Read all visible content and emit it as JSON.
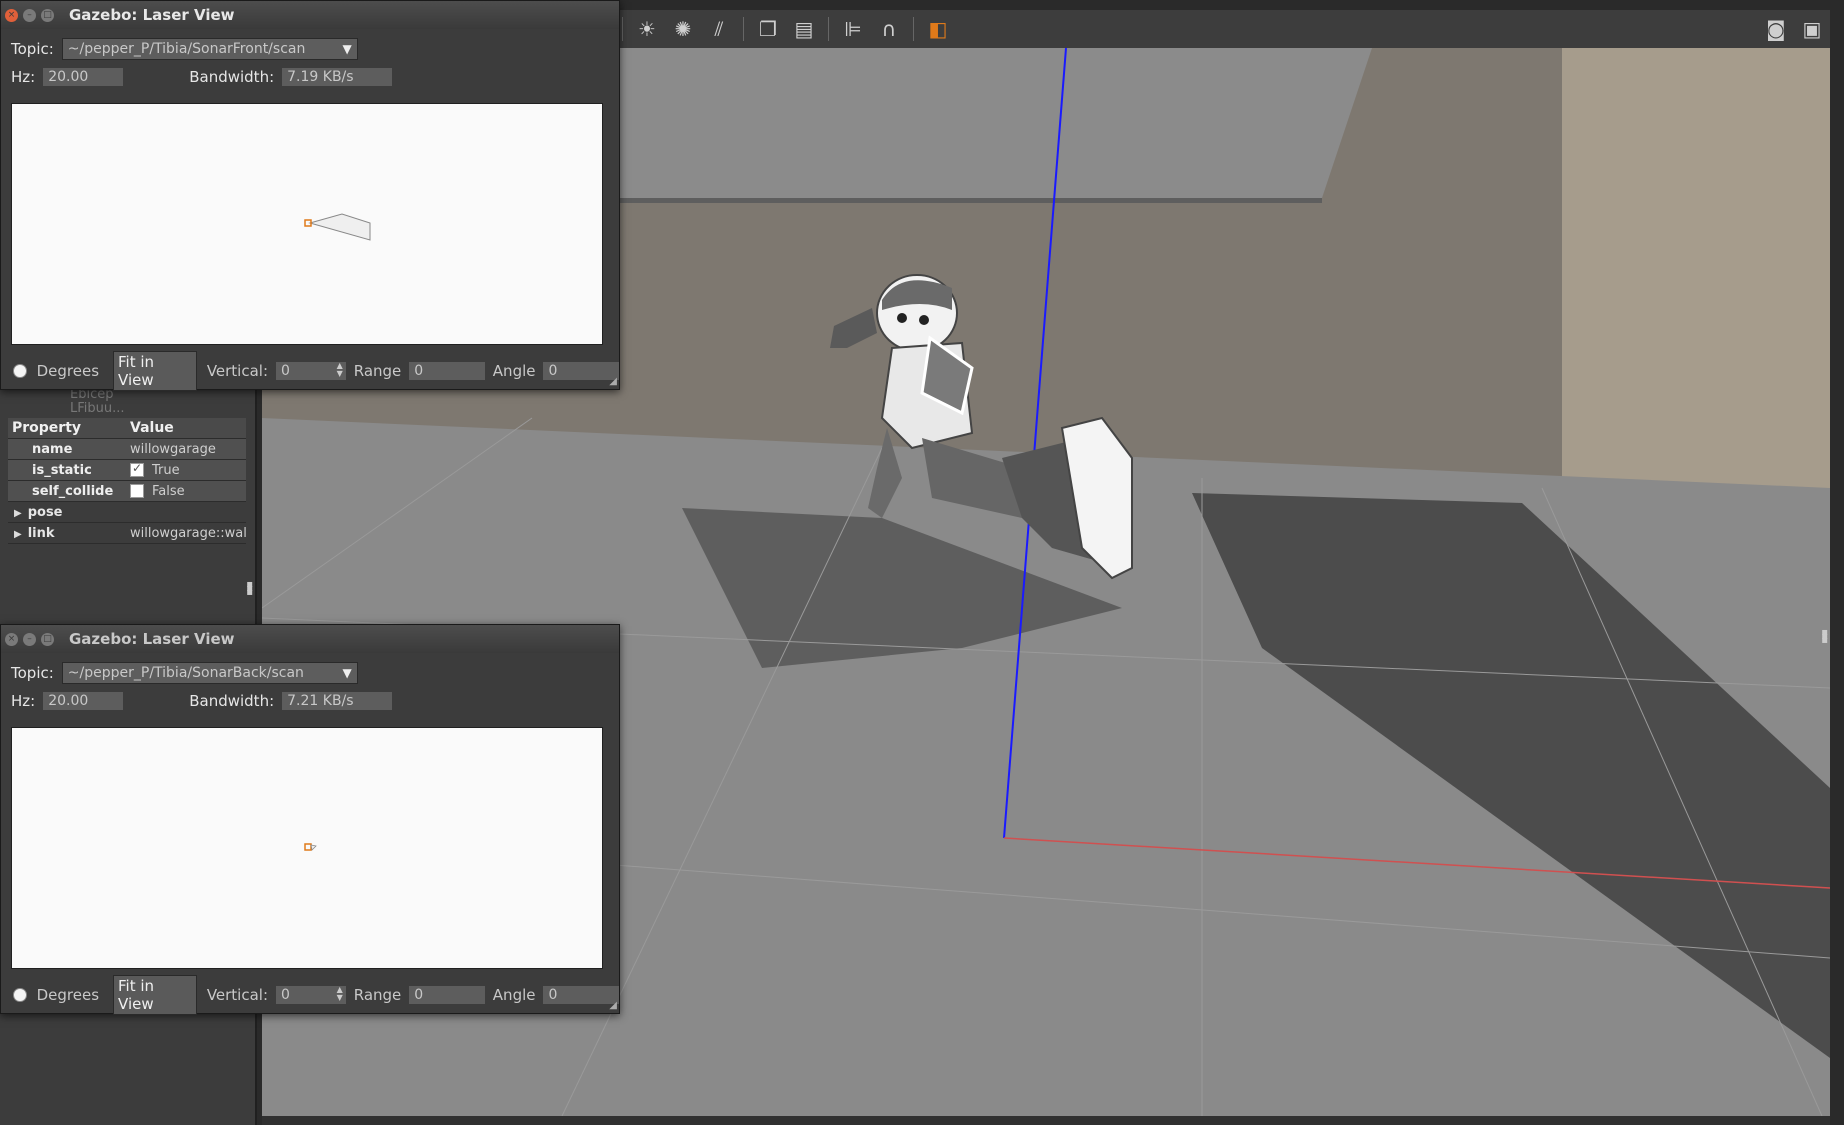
{
  "properties": {
    "header": {
      "property": "Property",
      "value": "Value"
    },
    "rows": [
      {
        "key": "name",
        "value": "willowgarage"
      },
      {
        "key": "is_static",
        "value": "True",
        "checked": true
      },
      {
        "key": "self_collide",
        "value": "False",
        "checked": false
      },
      {
        "key": "pose",
        "value": ""
      },
      {
        "key": "link",
        "value": "willowgarage::walls"
      }
    ],
    "ghost_text_1": "Ebicep",
    "ghost_text_2": "LFibuu..."
  },
  "toolbar_icons": [
    "sun-icon",
    "spotlight-icon",
    "directional-light-icon",
    "copy-icon",
    "paste-icon",
    "align-icon",
    "snap-magnet-icon",
    "view-angle-icon",
    "camera-icon",
    "log-icon"
  ],
  "laser_front": {
    "title": "Gazebo: Laser View",
    "topic_label": "Topic:",
    "topic": "~/pepper_P/Tibia/SonarFront/scan",
    "hz_label": "Hz:",
    "hz": "20.00",
    "bandwidth_label": "Bandwidth:",
    "bandwidth": "7.19 KB/s",
    "degrees_label": "Degrees",
    "fit_label": "Fit in View",
    "vertical_label": "Vertical:",
    "vertical": "0",
    "range_label": "Range",
    "range": "0",
    "angle_label": "Angle",
    "angle": "0"
  },
  "laser_back": {
    "title": "Gazebo: Laser View",
    "topic_label": "Topic:",
    "topic": "~/pepper_P/Tibia/SonarBack/scan",
    "hz_label": "Hz:",
    "hz": "20.00",
    "bandwidth_label": "Bandwidth:",
    "bandwidth": "7.21 KB/s",
    "degrees_label": "Degrees",
    "fit_label": "Fit in View",
    "vertical_label": "Vertical:",
    "vertical": "0",
    "range_label": "Range",
    "range": "0",
    "angle_label": "Angle",
    "angle": "0"
  },
  "colors": {
    "close_button": "#e0603a",
    "z_axis": "#1a1aff",
    "x_axis": "#d05050",
    "sensor_marker": "#e07a1a"
  }
}
